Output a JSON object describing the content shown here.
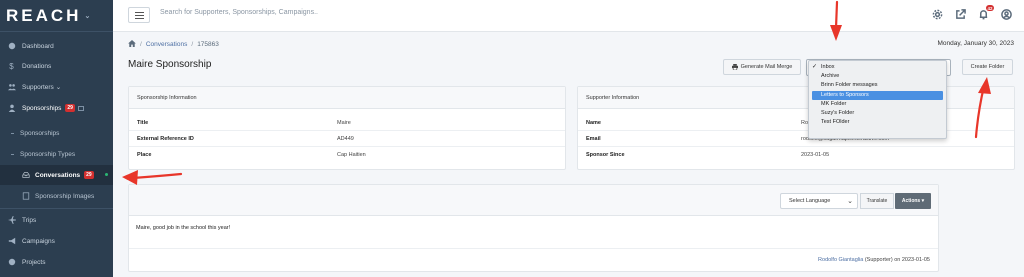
{
  "app": {
    "logo": "REACH",
    "logo_caret": "⌄"
  },
  "sidebar": {
    "items": [
      {
        "label": "Dashboard",
        "icon": "dashboard-icon"
      },
      {
        "label": "Donations",
        "icon": "dollar-icon"
      },
      {
        "label": "Supporters",
        "caret": "⌄",
        "icon": "users-icon"
      },
      {
        "label": "Sponsorships",
        "badge": "29",
        "icon": "user-icon"
      },
      {
        "label": "Trips",
        "icon": "plane-icon"
      },
      {
        "label": "Campaigns",
        "icon": "megaphone-icon"
      },
      {
        "label": "Projects",
        "icon": "globe-icon"
      }
    ],
    "subitems": [
      {
        "label": "Sponsorships"
      },
      {
        "label": "Sponsorship Types"
      },
      {
        "label": "Conversations",
        "badge": "29",
        "icon": "inbox-icon"
      },
      {
        "label": "Sponsorship Images",
        "icon": "image-icon"
      }
    ]
  },
  "topbar": {
    "search_placeholder": "Search for Supporters, Sponsorships, Campaigns..",
    "notification_count": "42"
  },
  "breadcrumb": {
    "items": [
      "Conversations",
      "175863"
    ]
  },
  "date": "Monday, January 30, 2023",
  "page_title": "Maire Sponsorship",
  "buttons": {
    "mail_merge": "Generate Mail Merge",
    "create_folder": "Create Folder",
    "translate": "Translate",
    "actions": "Actions ▾"
  },
  "folder_dropdown": {
    "options": [
      "Inbox",
      "Archive",
      "Brinn Folder messages",
      "Letters to Sponsors",
      "MK Folder",
      "Suzy's Folder",
      "Test FOlder"
    ],
    "checked": "Inbox",
    "highlighted": "Letters to Sponsors"
  },
  "sponsorship_info": {
    "header": "Sponsorship Information",
    "rows": [
      {
        "key": "Title",
        "value": "Maire"
      },
      {
        "key": "External Reference ID",
        "value": "AD449"
      },
      {
        "key": "Place",
        "value": "Cap Haitien"
      }
    ]
  },
  "supporter_info": {
    "header": "Supporter Information",
    "rows": [
      {
        "key": "Name",
        "value": "Ro"
      },
      {
        "key": "Email",
        "value": "rodolfo@sugarmapleinteractive.com"
      },
      {
        "key": "Sponsor Since",
        "value": "2023-01-05"
      }
    ]
  },
  "message": {
    "language_placeholder": "Select Language",
    "body": "Maire, good job in the school this year!",
    "author": "Rodolfo Giantaglia",
    "role": "(Supporter)",
    "date_prefix": "on",
    "date": "2023-01-05"
  }
}
